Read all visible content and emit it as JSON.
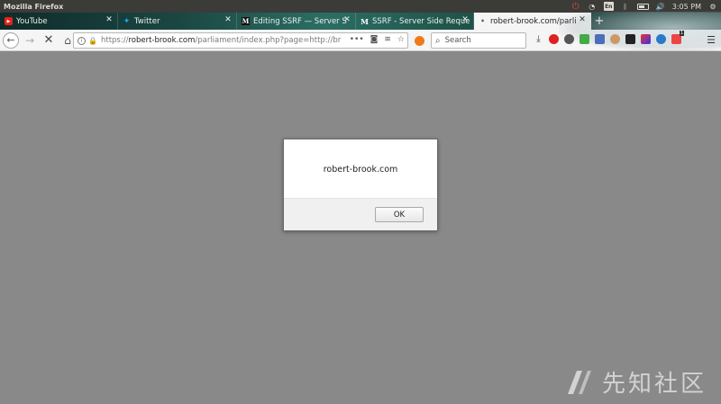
{
  "os": {
    "window_title": "Mozilla Firefox",
    "keyboard_layout": "En",
    "clock": "3:05 PM"
  },
  "tabs": [
    {
      "label": "YouTube",
      "favicon": "youtube-icon",
      "active": false
    },
    {
      "label": "Twitter",
      "favicon": "twitter-icon",
      "active": false
    },
    {
      "label": "Editing SSRF — Server S",
      "favicon": "medium-icon",
      "active": false
    },
    {
      "label": "SSRF - Server Side Reque",
      "favicon": "medium-icon",
      "active": false
    },
    {
      "label": "robert-brook.com/parli",
      "favicon": "page-icon",
      "active": true
    }
  ],
  "toolbar": {
    "url_prefix": "https://",
    "url_domain": "robert-brook.com",
    "url_path": "/parliament/index.php?page=http://br",
    "search_placeholder": "Search",
    "extension_badge": "1"
  },
  "dialog": {
    "message": "robert-brook.com",
    "ok_label": "OK"
  },
  "watermark": {
    "text": "先知社区"
  },
  "colors": {
    "page_background": "#898989",
    "secure_lock": "#12a33c",
    "tabstrip_theme": "#1b4742"
  }
}
